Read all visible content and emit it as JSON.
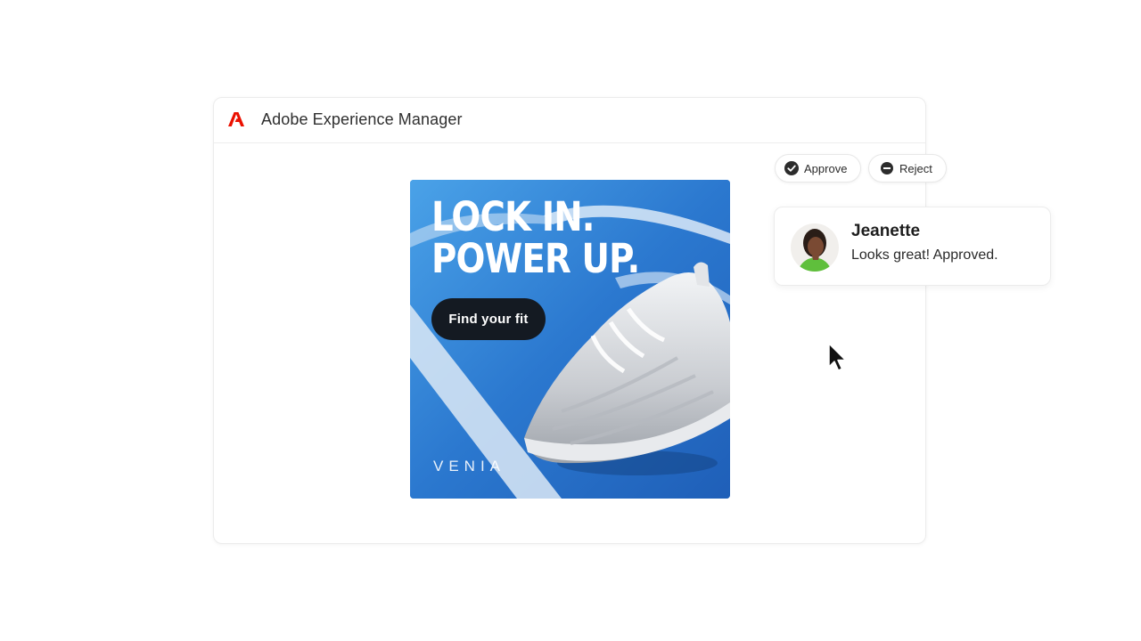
{
  "app": {
    "title": "Adobe Experience Manager",
    "logo_icon": "adobe-logo-icon",
    "brand_color": "#eb1000"
  },
  "creative": {
    "headline_line1": "LOCK IN.",
    "headline_line2": "POWER UP.",
    "cta_label": "Find your fit",
    "brand": "VENIA",
    "colors": {
      "background": "#2f7fd4",
      "cta": "#141a22"
    }
  },
  "review": {
    "approve_label": "Approve",
    "approve_icon": "check-circle-icon",
    "reject_label": "Reject",
    "reject_icon": "minus-circle-icon"
  },
  "comment": {
    "author": "Jeanette",
    "text": "Looks great! Approved.",
    "avatar_icon": "avatar"
  },
  "pointer": {
    "icon": "cursor-arrow-icon"
  }
}
